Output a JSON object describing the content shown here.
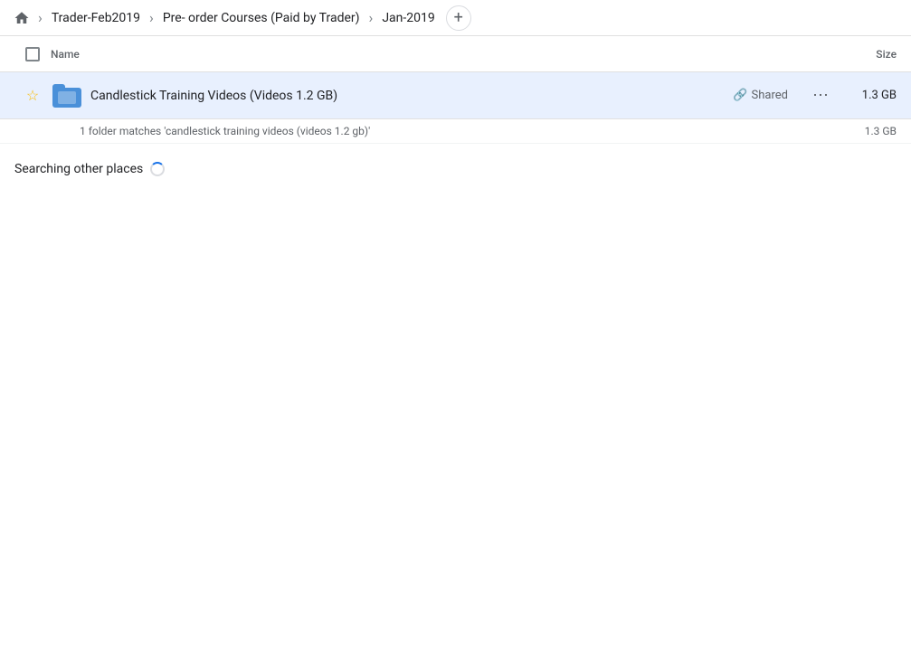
{
  "breadcrumb": {
    "home_icon": "🏠",
    "items": [
      {
        "label": "Trader-Feb2019",
        "id": "trader-feb2019"
      },
      {
        "label": "Pre- order Courses (Paid by Trader)",
        "id": "pre-order-courses"
      },
      {
        "label": "Jan-2019",
        "id": "jan-2019"
      }
    ],
    "add_icon": "+"
  },
  "columns": {
    "name_label": "Name",
    "size_label": "Size"
  },
  "file_row": {
    "star_icon": "☆",
    "name": "Candlestick Training Videos (Videos 1.2 GB)",
    "shared_label": "Shared",
    "more_icon": "⋯",
    "size": "1.3 GB"
  },
  "match_info": {
    "text": "1 folder matches 'candlestick training videos (videos 1.2 gb)'",
    "size": "1.3 GB"
  },
  "searching_section": {
    "title": "Searching other places",
    "has_spinner": true
  }
}
